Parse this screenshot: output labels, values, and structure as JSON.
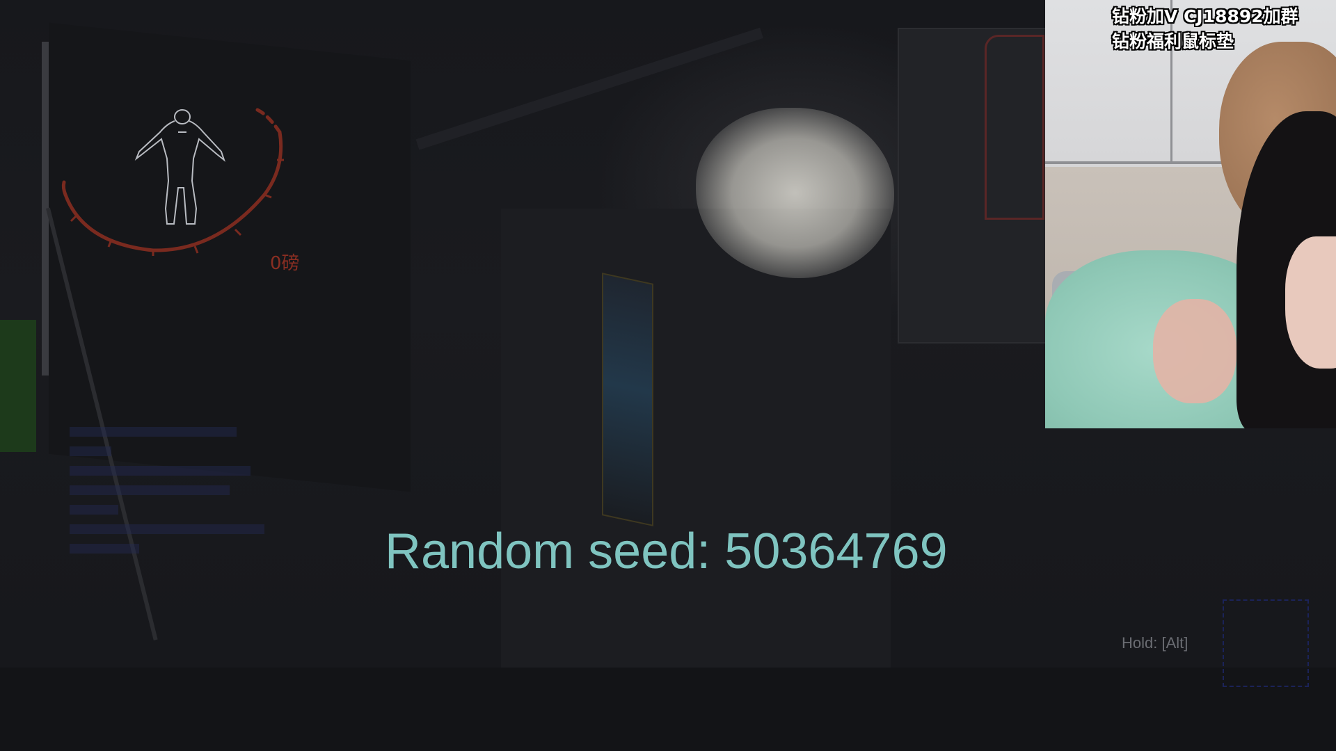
{
  "hud": {
    "weight_label": "0磅",
    "random_seed_text": "Random seed: 50364769",
    "hold_hint": "Hold: [Alt]",
    "accent_color": "#8a2e22",
    "seed_color": "#7fc4c0"
  },
  "webcam": {
    "caption_line_1": "钻粉加V CJ18892加群",
    "caption_line_2": "钻粉福利鼠标垫"
  }
}
